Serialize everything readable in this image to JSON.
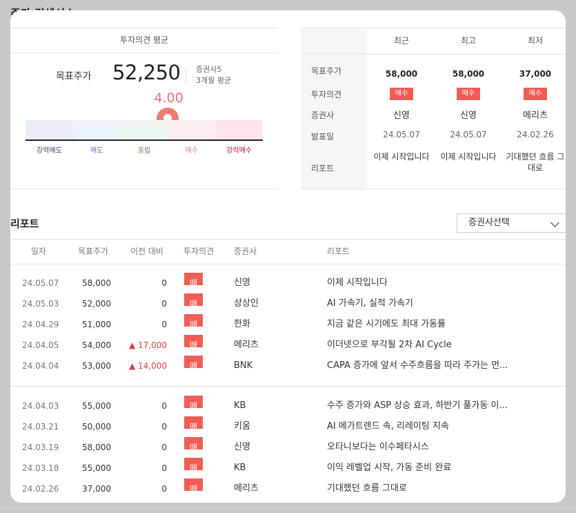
{
  "page_title": "주가 컨센서스",
  "consensus": {
    "header": "투자의견 평균",
    "target_label": "목표주가",
    "target_value": "52,250",
    "brokers": "증권사5",
    "period": "3개월 평균",
    "score": "4.00",
    "score_fraction": 0.6,
    "scale": [
      {
        "label": "강력매도",
        "bg": "#e9eef8",
        "color": "#2f3f6f"
      },
      {
        "label": "매도",
        "bg": "#edf3fc",
        "color": "#4a73c7"
      },
      {
        "label": "중립",
        "bg": "#edf7ef",
        "color": "#3f9a4f"
      },
      {
        "label": "매수",
        "bg": "#fdeeee",
        "color": "#ef6f6f"
      },
      {
        "label": "강력매수",
        "bg": "#fde6e8",
        "color": "#b21d2a"
      }
    ]
  },
  "summary": {
    "columns": [
      "최근",
      "최고",
      "최저"
    ],
    "row_labels": [
      "목표주가",
      "투자의견",
      "증권사",
      "발표일",
      "리포트"
    ],
    "cols": [
      {
        "target": "58,000",
        "opinion": "매수",
        "broker": "신영",
        "date": "24.05.07",
        "report": "이제 시작입니다"
      },
      {
        "target": "58,000",
        "opinion": "매수",
        "broker": "신영",
        "date": "24.05.07",
        "report": "이제 시작입니다"
      },
      {
        "target": "37,000",
        "opinion": "매수",
        "broker": "메리츠",
        "date": "24.02.26",
        "report": "기대했던 흐름 그대로"
      }
    ]
  },
  "reports": {
    "title": "리포트",
    "select_label": "증권사선택",
    "headers": [
      "일자",
      "목표주가",
      "이전 대비",
      "투자의견",
      "증권사",
      "리포트"
    ],
    "rows": [
      {
        "date": "24.05.07",
        "target": "58,000",
        "diff": "0",
        "up": false,
        "opinion": "매수",
        "broker": "신영",
        "report": "이제 시작입니다"
      },
      {
        "date": "24.05.03",
        "target": "52,000",
        "diff": "0",
        "up": false,
        "opinion": "매수",
        "broker": "상상인",
        "report": "AI 가속기, 실적 가속기"
      },
      {
        "date": "24.04.29",
        "target": "51,000",
        "diff": "0",
        "up": false,
        "opinion": "매수",
        "broker": "한화",
        "report": "지금 같은 시기에도 최대 가동률"
      },
      {
        "date": "24.04.05",
        "target": "54,000",
        "diff": "▲ 17,000",
        "up": true,
        "opinion": "매수",
        "broker": "메리츠",
        "report": "이더넷으로 부각될 2차 AI Cycle"
      },
      {
        "date": "24.04.04",
        "target": "53,000",
        "diff": "▲ 14,000",
        "up": true,
        "opinion": "매수",
        "broker": "BNK",
        "report": "CAPA 증가에 앞서 수주흐름을 따라 주가는 먼..."
      },
      {
        "date": "24.04.03",
        "target": "55,000",
        "diff": "0",
        "up": false,
        "opinion": "매수",
        "broker": "KB",
        "report": "수주 증가와 ASP 상승 효과, 하반기 풀가동 이..."
      },
      {
        "date": "24.03.21",
        "target": "50,000",
        "diff": "0",
        "up": false,
        "opinion": "매수",
        "broker": "키움",
        "report": "AI 메가트렌드 속, 리레이팅 지속"
      },
      {
        "date": "24.03.19",
        "target": "58,000",
        "diff": "0",
        "up": false,
        "opinion": "매수",
        "broker": "신영",
        "report": "오타니보다는 이수페타시스"
      },
      {
        "date": "24.03.18",
        "target": "55,000",
        "diff": "0",
        "up": false,
        "opinion": "매수",
        "broker": "KB",
        "report": "이익 레벨업 시작, 가동 준비 완료"
      },
      {
        "date": "24.02.26",
        "target": "37,000",
        "diff": "0",
        "up": false,
        "opinion": "매수",
        "broker": "메리츠",
        "report": "기대했던 흐름 그대로"
      }
    ]
  }
}
